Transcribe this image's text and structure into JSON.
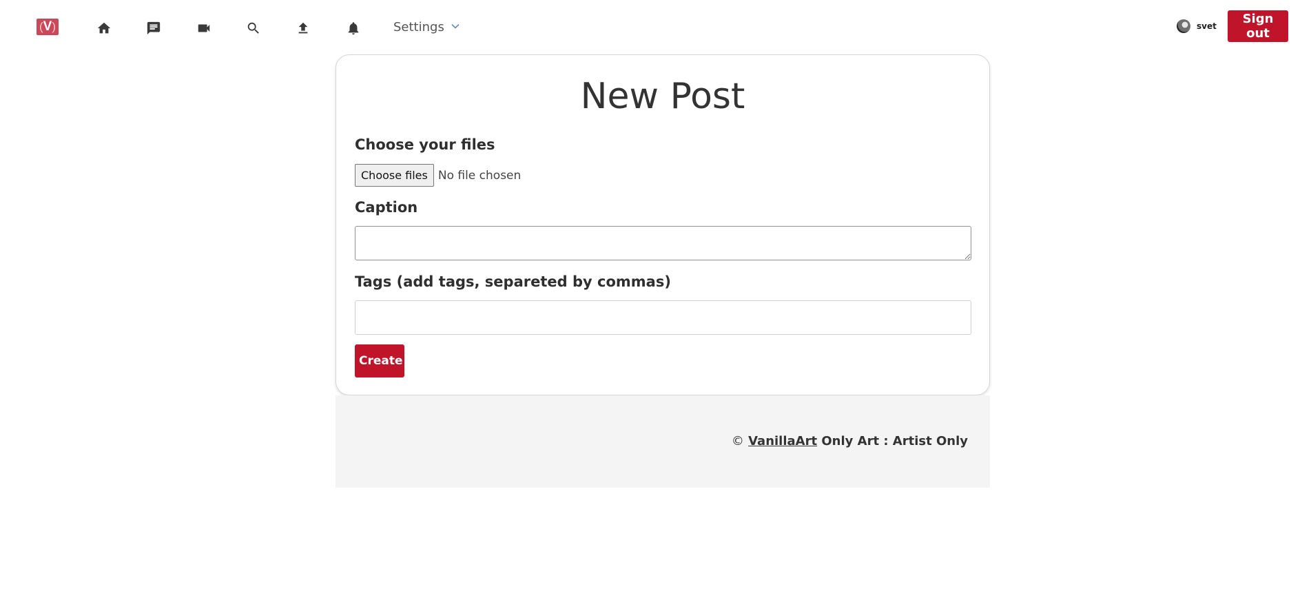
{
  "header": {
    "logo_text": "V",
    "nav_icons": [
      "home-icon",
      "chat-icon",
      "video-camera-icon",
      "search-icon",
      "upload-icon",
      "bell-icon"
    ],
    "settings_label": "Settings",
    "username": "svet",
    "signout_label": "Sign out",
    "accent_color": "#c0142a"
  },
  "form": {
    "title": "New Post",
    "files_label": "Choose your files",
    "choose_files_button": "Choose files",
    "file_status": "No file chosen",
    "caption_label": "Caption",
    "caption_value": "",
    "tags_label": "Tags (add tags, separeted by commas)",
    "tags_value": "",
    "create_label": "Create"
  },
  "footer": {
    "copyright_symbol": "©",
    "brand_link": "VanillaArt",
    "tagline": "Only Art : Artist Only"
  }
}
